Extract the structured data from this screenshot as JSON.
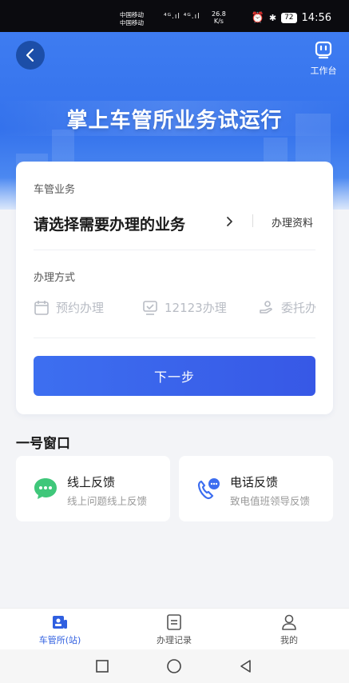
{
  "status_bar": {
    "carrier1": "中国移动",
    "carrier2": "中国移动",
    "signal": "⁴ᴳ.ıl ⁴ᴳ.ıl",
    "speed_value": "26.8",
    "speed_unit": "K/s",
    "battery": "72",
    "time": "14:56"
  },
  "header": {
    "workbench_label": "工作台",
    "banner_title": "掌上车管所业务试运行"
  },
  "business": {
    "section_label": "车管业务",
    "select_prompt": "请选择需要办理的业务",
    "docs_link": "办理资料"
  },
  "methods": {
    "section_label": "办理方式",
    "options": [
      "预约办理",
      "12123办理",
      "委托办"
    ]
  },
  "next_button": "下一步",
  "window_section": {
    "title": "一号窗口",
    "cards": [
      {
        "title": "线上反馈",
        "subtitle": "线上问题线上反馈",
        "icon": "chat-bubble-icon"
      },
      {
        "title": "电话反馈",
        "subtitle": "致电值班领导反馈",
        "icon": "phone-chat-icon"
      }
    ]
  },
  "tabs": [
    {
      "label": "车管所(站)",
      "icon": "vehicle-office-icon",
      "active": true
    },
    {
      "label": "办理记录",
      "icon": "records-icon",
      "active": false
    },
    {
      "label": "我的",
      "icon": "profile-icon",
      "active": false
    }
  ],
  "colors": {
    "primary": "#3472ec",
    "button": "#3d6ff0",
    "green": "#3fc77a",
    "muted": "#b8bcc4"
  }
}
